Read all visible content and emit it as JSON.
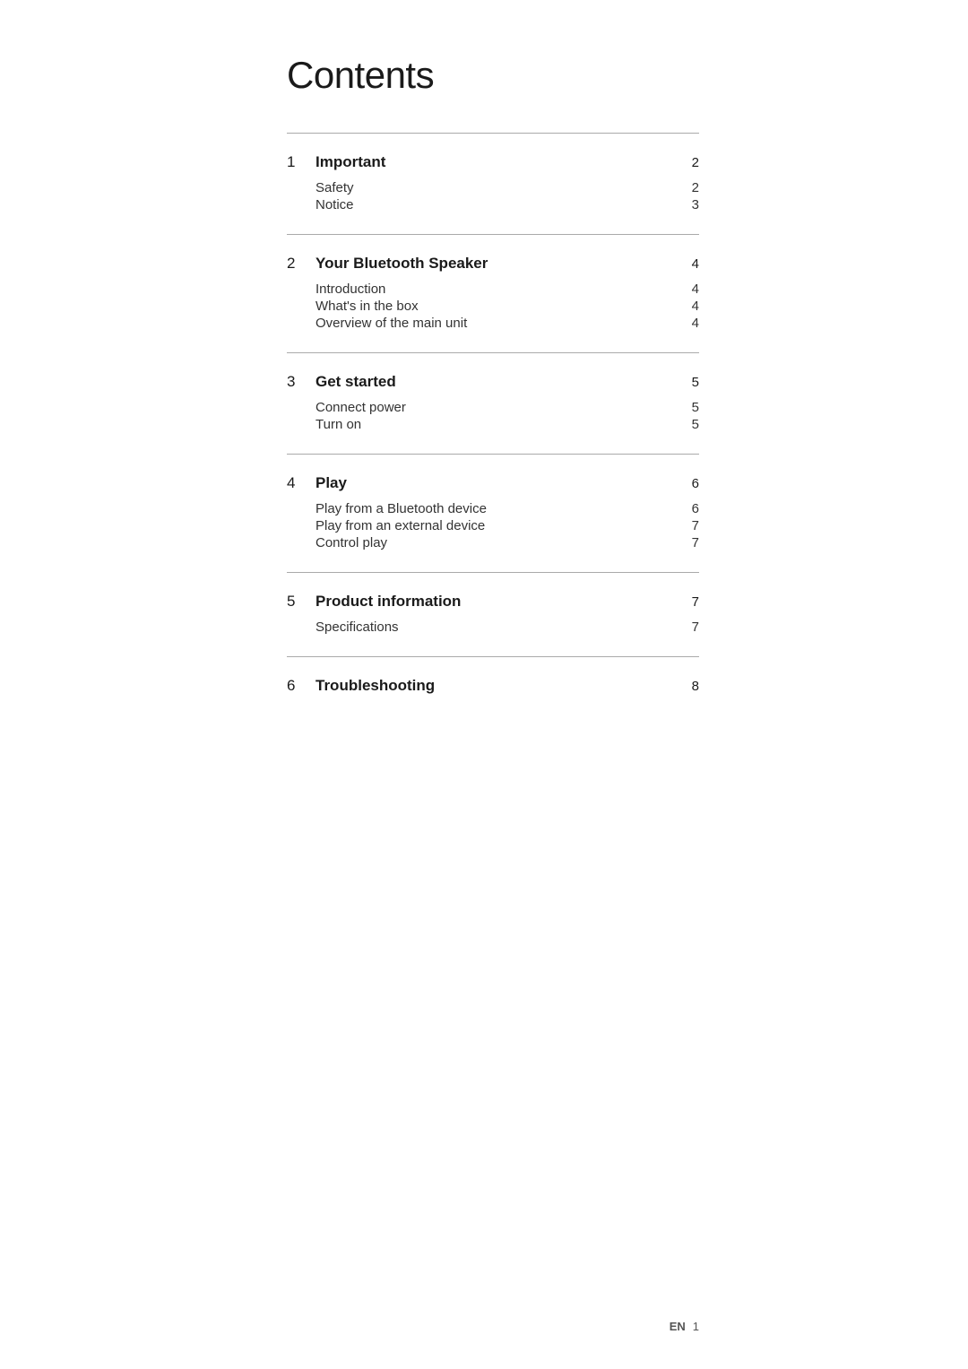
{
  "page": {
    "title": "Contents",
    "footer": {
      "lang": "EN",
      "page_number": "1"
    }
  },
  "sections": [
    {
      "number": "1",
      "title": "Important",
      "page": "2",
      "sub_items": [
        {
          "label": "Safety",
          "page": "2"
        },
        {
          "label": "Notice",
          "page": "3"
        }
      ]
    },
    {
      "number": "2",
      "title": "Your Bluetooth Speaker",
      "page": "4",
      "sub_items": [
        {
          "label": "Introduction",
          "page": "4"
        },
        {
          "label": "What's in the box",
          "page": "4"
        },
        {
          "label": "Overview of the main unit",
          "page": "4"
        }
      ]
    },
    {
      "number": "3",
      "title": "Get started",
      "page": "5",
      "sub_items": [
        {
          "label": "Connect power",
          "page": "5"
        },
        {
          "label": "Turn on",
          "page": "5"
        }
      ]
    },
    {
      "number": "4",
      "title": "Play",
      "page": "6",
      "sub_items": [
        {
          "label": "Play from a Bluetooth device",
          "page": "6"
        },
        {
          "label": "Play from an external device",
          "page": "7"
        },
        {
          "label": "Control play",
          "page": "7"
        }
      ]
    },
    {
      "number": "5",
      "title": "Product information",
      "page": "7",
      "sub_items": [
        {
          "label": "Specifications",
          "page": "7"
        }
      ]
    },
    {
      "number": "6",
      "title": "Troubleshooting",
      "page": "8",
      "sub_items": []
    }
  ]
}
